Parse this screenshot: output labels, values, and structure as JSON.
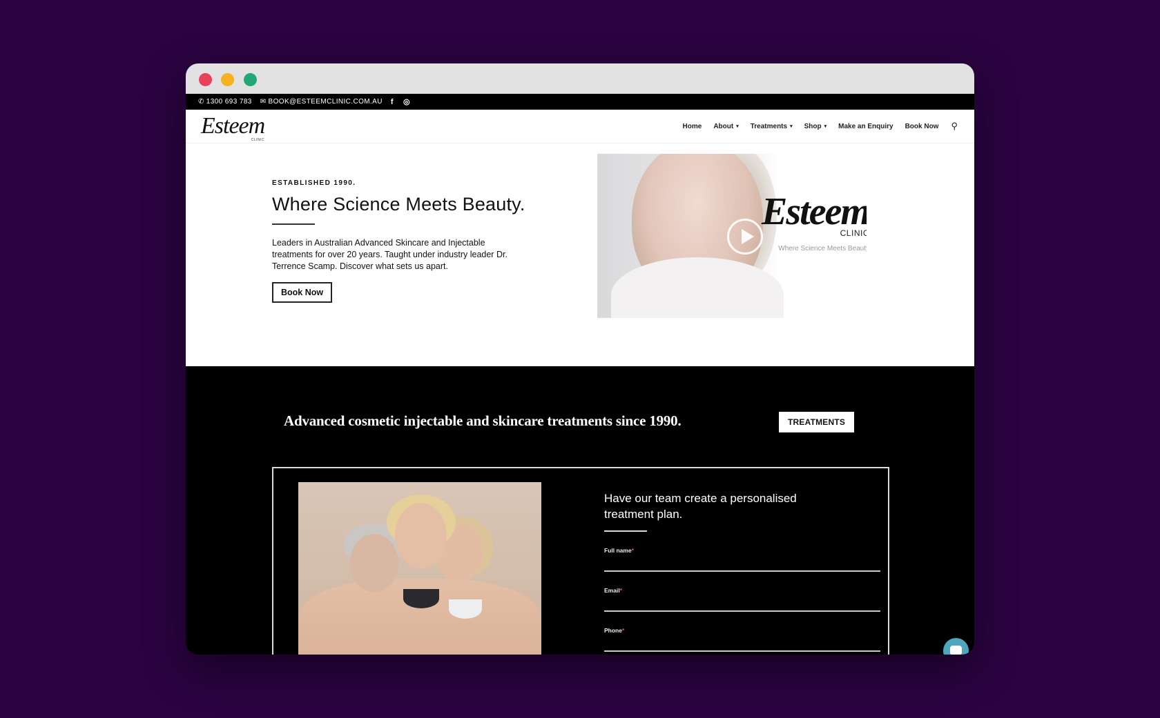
{
  "window": {
    "traffic_lights": [
      "close",
      "minimize",
      "maximize"
    ]
  },
  "topbar": {
    "phone_icon": "phone-icon",
    "phone": "1300 693 783",
    "email_icon": "envelope-icon",
    "email": "BOOK@ESTEEMCLINIC.COM.AU",
    "facebook_glyph": "f",
    "instagram_glyph": "◎"
  },
  "header": {
    "logo_text": "Esteem",
    "logo_sub": "CLINIC",
    "nav": [
      {
        "label": "Home",
        "has_dropdown": false
      },
      {
        "label": "About",
        "has_dropdown": true
      },
      {
        "label": "Treatments",
        "has_dropdown": true
      },
      {
        "label": "Shop",
        "has_dropdown": true
      },
      {
        "label": "Make an Enquiry",
        "has_dropdown": false
      },
      {
        "label": "Book Now",
        "has_dropdown": false
      }
    ],
    "chevron": "⌄",
    "search_glyph": "⚲"
  },
  "hero": {
    "eyebrow": "ESTABLISHED 1990.",
    "title": "Where Science Meets Beauty.",
    "body": "Leaders in Australian Advanced Skincare and Injectable treatments for over 20 years. Taught under industry leader Dr. Terrence Scamp. Discover what sets us apart.",
    "button": "Book Now",
    "video": {
      "logo": "Esteem",
      "logo_sub": "CLINIC",
      "tagline": "Where Science Meets Beauty"
    }
  },
  "cta": {
    "text": "Advanced cosmetic injectable and skincare treatments since 1990.",
    "button": "TREATMENTS"
  },
  "form": {
    "title": "Have our team create a personalised treatment plan.",
    "fields": [
      {
        "label": "Full name",
        "required": "*",
        "value": ""
      },
      {
        "label": "Email",
        "required": "*",
        "value": ""
      },
      {
        "label": "Phone",
        "required": "*",
        "value": ""
      }
    ]
  }
}
